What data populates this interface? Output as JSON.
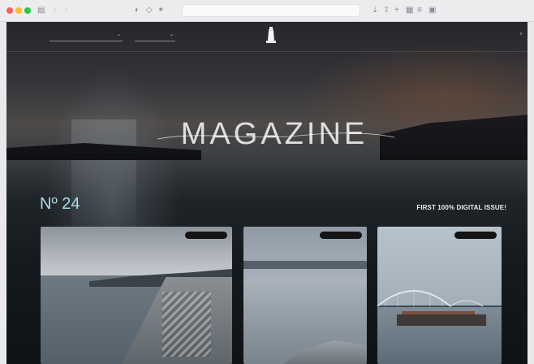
{
  "browser": {
    "address_text": "",
    "icons": [
      "back-icon",
      "forward-icon",
      "sidebar-icon",
      "shield-icon",
      "share-icon",
      "new-tab-icon",
      "tabs-icon"
    ]
  },
  "nav": {
    "menu_label": "",
    "dropdown1_value": "",
    "dropdown2_value": "",
    "right_link": ""
  },
  "hero": {
    "kicker": "",
    "title": "MAGAZINE"
  },
  "issue": {
    "label": "",
    "number": "Nº 24",
    "note": "FIRST 100% DIGITAL ISSUE!"
  },
  "cards": [
    {
      "badge": ""
    },
    {
      "badge": ""
    },
    {
      "badge": ""
    }
  ],
  "colors": {
    "accent_issue_number": "#a9dde8",
    "badge_bg": "#141414"
  }
}
